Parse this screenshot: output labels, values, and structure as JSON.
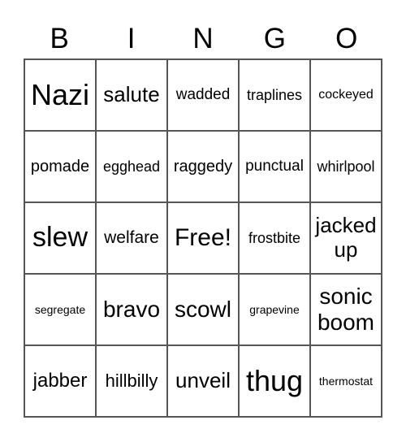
{
  "header": [
    "B",
    "I",
    "N",
    "G",
    "O"
  ],
  "cells": [
    {
      "text": "Nazi",
      "size": 36
    },
    {
      "text": "salute",
      "size": 26
    },
    {
      "text": "wadded",
      "size": 19
    },
    {
      "text": "traplines",
      "size": 18
    },
    {
      "text": "cockeyed",
      "size": 16
    },
    {
      "text": "pomade",
      "size": 20
    },
    {
      "text": "egghead",
      "size": 18
    },
    {
      "text": "raggedy",
      "size": 20
    },
    {
      "text": "punctual",
      "size": 19
    },
    {
      "text": "whirlpool",
      "size": 18
    },
    {
      "text": "slew",
      "size": 34
    },
    {
      "text": "welfare",
      "size": 21
    },
    {
      "text": "Free!",
      "size": 30
    },
    {
      "text": "frostbite",
      "size": 18
    },
    {
      "text": "jacked up",
      "size": 26
    },
    {
      "text": "segregate",
      "size": 14
    },
    {
      "text": "bravo",
      "size": 28
    },
    {
      "text": "scowl",
      "size": 28
    },
    {
      "text": "grapevine",
      "size": 14
    },
    {
      "text": "sonic boom",
      "size": 28
    },
    {
      "text": "jabber",
      "size": 24
    },
    {
      "text": "hillbilly",
      "size": 22
    },
    {
      "text": "unveil",
      "size": 26
    },
    {
      "text": "thug",
      "size": 36
    },
    {
      "text": "thermostat",
      "size": 14
    }
  ]
}
